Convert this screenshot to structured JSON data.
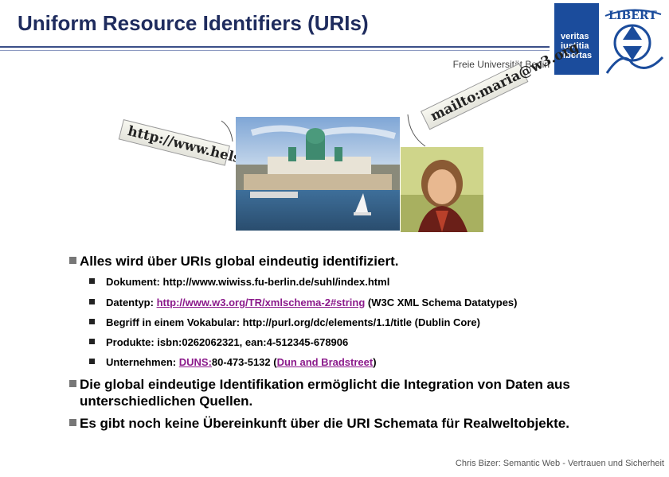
{
  "title": "Uniform Resource Identifiers (URIs)",
  "university": "Freie Universität Berlin",
  "logo": {
    "lines": [
      "veritas",
      "iustitia",
      "libertas"
    ],
    "seal_text": "LIBERT"
  },
  "tags": {
    "left": "http://www.helsinki.fi",
    "right": "mailto:maria@w3.org"
  },
  "bullets": [
    {
      "text": "Alles wird über URIs global eindeutig identifiziert."
    },
    {
      "text": "Die global eindeutige Identifikation ermöglicht die Integration von Daten aus unterschiedlichen Quellen."
    },
    {
      "text": "Es gibt noch keine Übereinkunft über die URI Schemata für Realweltobjekte."
    }
  ],
  "subbullets": {
    "doc": "Dokument: http://www.wiwiss.fu-berlin.de/suhl/index.html",
    "type_prefix": "Datentyp: ",
    "type_link": "http://www.w3.org/TR/xmlschema-2#string",
    "type_suffix": " (W3C XML Schema Datatypes)",
    "vocab": "Begriff in einem Vokabular: http://purl.org/dc/elements/1.1/title (Dublin Core)",
    "products": "Produkte: isbn:0262062321,  ean:4-512345-678906",
    "company_prefix": "Unternehmen: ",
    "company_link": "DUNS:",
    "company_mid": "80-473-5132 (",
    "company_link2": "Dun and Bradstreet",
    "company_suffix": ")"
  },
  "footer": "Chris Bizer: Semantic Web - Vertrauen und Sicherheit"
}
